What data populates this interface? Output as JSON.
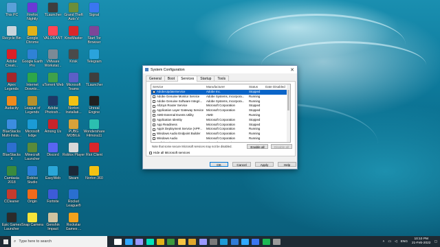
{
  "desktop": {
    "icons": [
      {
        "label": "This PC",
        "color": "#5aa0d8",
        "col": 0,
        "row": 0
      },
      {
        "label": "Recycle Bin",
        "color": "#c8d4dc",
        "col": 0,
        "row": 1
      },
      {
        "label": "Adobe\nCreati...",
        "color": "#da1f26",
        "col": 0,
        "row": 2
      },
      {
        "label": "Apex\nLegends",
        "color": "#a3262a",
        "col": 0,
        "row": 3
      },
      {
        "label": "Audacity",
        "color": "#f08a1c",
        "col": 0,
        "row": 4
      },
      {
        "label": "BlueStacks\nMulti-Insta...",
        "color": "#3c8de0",
        "col": 0,
        "row": 5
      },
      {
        "label": "BlueStacks\nX",
        "color": "#2d6fd0",
        "col": 0,
        "row": 6
      },
      {
        "label": "Camtasia\n2018",
        "color": "#3a8a3e",
        "col": 0,
        "row": 7
      },
      {
        "label": "CCleaner",
        "color": "#c43b2e",
        "col": 0,
        "row": 8
      },
      {
        "label": "Epic Games\nLauncher",
        "color": "#2b2b2b",
        "col": 0,
        "row": 9
      },
      {
        "label": "Firefox\nNightly",
        "color": "#6a39d6",
        "col": 1,
        "row": 0
      },
      {
        "label": "Google\nChrome",
        "color": "#e2b218",
        "col": 1,
        "row": 1
      },
      {
        "label": "Google Earth\nPro",
        "color": "#2f82d6",
        "col": 1,
        "row": 2
      },
      {
        "label": "Internet\nDownlo...",
        "color": "#2da64a",
        "col": 1,
        "row": 3
      },
      {
        "label": "League of\nLegends",
        "color": "#b8912c",
        "col": 1,
        "row": 4
      },
      {
        "label": "Microsoft\nEdge",
        "color": "#1b9bd6",
        "col": 1,
        "row": 5
      },
      {
        "label": "Minecraft\nLauncher",
        "color": "#5a8a3a",
        "col": 1,
        "row": 6
      },
      {
        "label": "Roblox\nStudio",
        "color": "#2c7fd8",
        "col": 1,
        "row": 7
      },
      {
        "label": "Origin",
        "color": "#f06a1a",
        "col": 1,
        "row": 8
      },
      {
        "label": "Snap Camera",
        "color": "#f5e43a",
        "col": 1,
        "row": 9
      },
      {
        "label": "TLauncher",
        "color": "#3e3e3e",
        "col": 2,
        "row": 0
      },
      {
        "label": "VALORANT",
        "color": "#ff4655",
        "col": 2,
        "row": 1
      },
      {
        "label": "VMware\nWorkstat...",
        "color": "#7a8a96",
        "col": 2,
        "row": 2
      },
      {
        "label": "uTorrent Web",
        "color": "#3fa14a",
        "col": 2,
        "row": 3
      },
      {
        "label": "Adobe\nPhotosh...",
        "color": "#1e3a66",
        "col": 2,
        "row": 4
      },
      {
        "label": "Among Us",
        "color": "#c8242a",
        "col": 2,
        "row": 5
      },
      {
        "label": "Discord",
        "color": "#5865f2",
        "col": 2,
        "row": 6
      },
      {
        "label": "EasyWeb",
        "color": "#2aa6d8",
        "col": 2,
        "row": 7
      },
      {
        "label": "Fortnite",
        "color": "#3d5bd8",
        "col": 2,
        "row": 8
      },
      {
        "label": "Genshin\nImpact",
        "color": "#cfc3a0",
        "col": 2,
        "row": 9
      },
      {
        "label": "Grand Theft\nAuto V",
        "color": "#6b8e3a",
        "col": 3,
        "row": 0
      },
      {
        "label": "KineMaster",
        "color": "#d8262a",
        "col": 3,
        "row": 1
      },
      {
        "label": "Krisk",
        "color": "#4a4a4a",
        "col": 3,
        "row": 2
      },
      {
        "label": "Microsoft\nTeams",
        "color": "#5b5fc7",
        "col": 3,
        "row": 3
      },
      {
        "label": "Norton\nInstallati...",
        "color": "#f3c212",
        "col": 3,
        "row": 4
      },
      {
        "label": "PUBG\nMOBILE",
        "color": "#d8a23a",
        "col": 3,
        "row": 5
      },
      {
        "label": "Roblox Player",
        "color": "#d8d8d8",
        "col": 3,
        "row": 6
      },
      {
        "label": "Steam",
        "color": "#1b2838",
        "col": 3,
        "row": 7
      },
      {
        "label": "Rocket\nLeague®",
        "color": "#2a6fd0",
        "col": 3,
        "row": 8
      },
      {
        "label": "Rockstar\nGames ...",
        "color": "#f2a21c",
        "col": 3,
        "row": 9
      },
      {
        "label": "Signal",
        "color": "#3a76f0",
        "col": 4,
        "row": 0
      },
      {
        "label": "Start Tor\nBrowser",
        "color": "#7d4698",
        "col": 4,
        "row": 1
      },
      {
        "label": "Telegram",
        "color": "#2aa3dc",
        "col": 4,
        "row": 2
      },
      {
        "label": "TLauncher",
        "color": "#3e3e3e",
        "col": 4,
        "row": 3
      },
      {
        "label": "Unreal\nEngine",
        "color": "#202020",
        "col": 4,
        "row": 4
      },
      {
        "label": "Wondershare\nFilmora11",
        "color": "#2bbfb0",
        "col": 4,
        "row": 5
      },
      {
        "label": "Riot Client",
        "color": "#d8262a",
        "col": 4,
        "row": 6
      },
      {
        "label": "Norton 360",
        "color": "#f3c212",
        "col": 4,
        "row": 7
      }
    ]
  },
  "dialog": {
    "title": "System Configuration",
    "close": "✕",
    "tabs": [
      "General",
      "Boot",
      "Services",
      "Startup",
      "Tools"
    ],
    "active_tab": "Services",
    "columns": {
      "service": "Service",
      "manufacturer": "Manufacturer",
      "status": "Status",
      "date_disabled": "Date Disabled"
    },
    "services": [
      {
        "name": "AdobeUpdateService",
        "manufacturer": "Adobe Inc.",
        "status": "Stopped",
        "date": "",
        "checked": false,
        "selected": true
      },
      {
        "name": "Adobe Genuine Monitor Service",
        "manufacturer": "Adobe Systems, Incorpora...",
        "status": "Running",
        "date": "",
        "checked": false,
        "selected": false
      },
      {
        "name": "Adobe Genuine Software Integri...",
        "manufacturer": "Adobe Systems, Incorpora...",
        "status": "Running",
        "date": "",
        "checked": false,
        "selected": false
      },
      {
        "name": "AllJoyn Router Service",
        "manufacturer": "Microsoft Corporation",
        "status": "Stopped",
        "date": "",
        "checked": false,
        "selected": false
      },
      {
        "name": "Application Layer Gateway Service",
        "manufacturer": "Microsoft Corporation",
        "status": "Stopped",
        "date": "",
        "checked": false,
        "selected": false
      },
      {
        "name": "AMD External Events Utility",
        "manufacturer": "AMD",
        "status": "Running",
        "date": "",
        "checked": false,
        "selected": false
      },
      {
        "name": "Application Identity",
        "manufacturer": "Microsoft Corporation",
        "status": "Stopped",
        "date": "",
        "checked": false,
        "selected": false
      },
      {
        "name": "App Readiness",
        "manufacturer": "Microsoft Corporation",
        "status": "Stopped",
        "date": "",
        "checked": false,
        "selected": false
      },
      {
        "name": "AppX Deployment Service (APP...",
        "manufacturer": "Microsoft Corporation",
        "status": "Running",
        "date": "",
        "checked": false,
        "selected": false
      },
      {
        "name": "Windows Audio Endpoint Builder",
        "manufacturer": "Microsoft Corporation",
        "status": "Running",
        "date": "",
        "checked": false,
        "selected": false
      },
      {
        "name": "Windows Audio",
        "manufacturer": "Microsoft Corporation",
        "status": "Running",
        "date": "",
        "checked": false,
        "selected": false
      },
      {
        "name": "Cellular Time",
        "manufacturer": "Microsoft Corporation",
        "status": "Stopped",
        "date": "",
        "checked": false,
        "selected": false
      }
    ],
    "note": "Note that some secure Microsoft services may not be disabled.",
    "enable_all": "Enable all",
    "disable_all": "Disable all",
    "hide_ms": "Hide all Microsoft services",
    "ok": "OK",
    "cancel": "Cancel",
    "apply": "Apply",
    "help": "Help"
  },
  "taskbar": {
    "search_placeholder": "Type here to search",
    "pinned": [
      {
        "name": "task-view",
        "color": "#ffffff"
      },
      {
        "name": "photoshop",
        "color": "#31a8ff"
      },
      {
        "name": "premiere",
        "color": "#9999ff"
      },
      {
        "name": "audition",
        "color": "#00e4bb"
      },
      {
        "name": "chrome",
        "color": "#e2b218"
      },
      {
        "name": "camtasia",
        "color": "#3a9a3e"
      },
      {
        "name": "file-explorer",
        "color": "#f5c542"
      },
      {
        "name": "folder",
        "color": "#e0a72a"
      },
      {
        "name": "after-effects",
        "color": "#9999ff"
      },
      {
        "name": "media",
        "color": "#7a7a7a"
      },
      {
        "name": "edge",
        "color": "#1b9bd6"
      },
      {
        "name": "mail",
        "color": "#2f7bd6"
      },
      {
        "name": "photoshop-2",
        "color": "#31a8ff"
      },
      {
        "name": "store",
        "color": "#3a76f0"
      },
      {
        "name": "spotify",
        "color": "#1db954"
      },
      {
        "name": "settings",
        "color": "#9a9a9a"
      }
    ],
    "language": "ENG",
    "time": "10:10 PM",
    "date": "21-Feb-2022"
  }
}
